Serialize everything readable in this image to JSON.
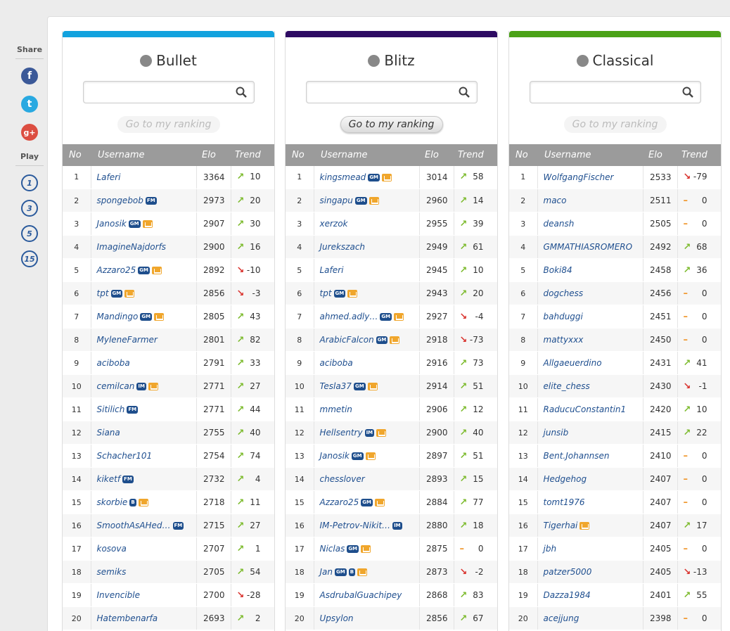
{
  "share": {
    "title": "Share",
    "items": [
      "f",
      "t",
      "g+"
    ]
  },
  "play": {
    "title": "Play",
    "items": [
      "1",
      "3",
      "5",
      "15"
    ]
  },
  "columns_header": {
    "no": "No",
    "username": "Username",
    "elo": "Elo",
    "trend": "Trend"
  },
  "goto_label": "Go to my ranking",
  "colors": {
    "bullet": "#12a2de",
    "blitz": "#2e0b63",
    "classical": "#4ba217",
    "up": "#7dbb2e",
    "down": "#d9322d",
    "flat": "#f0962b"
  },
  "panels": [
    {
      "id": "bullet",
      "title": "Bullet",
      "icon": "bullet-icon",
      "goto_active": false,
      "rows": [
        {
          "no": "1",
          "user": "Laferi",
          "badges": [],
          "elo": "3364",
          "dir": "up",
          "trend": "10"
        },
        {
          "no": "2",
          "user": "spongebob",
          "badges": [
            "FM"
          ],
          "elo": "2973",
          "dir": "up",
          "trend": "20"
        },
        {
          "no": "3",
          "user": "Janosik",
          "badges": [
            "GM",
            "crown"
          ],
          "elo": "2907",
          "dir": "up",
          "trend": "30"
        },
        {
          "no": "4",
          "user": "ImagineNajdorfs",
          "badges": [],
          "elo": "2900",
          "dir": "up",
          "trend": "16"
        },
        {
          "no": "5",
          "user": "Azzaro25",
          "badges": [
            "GM",
            "crown"
          ],
          "elo": "2892",
          "dir": "down",
          "trend": "-10"
        },
        {
          "no": "6",
          "user": "tpt",
          "badges": [
            "GM",
            "crown"
          ],
          "elo": "2856",
          "dir": "down",
          "trend": "-3"
        },
        {
          "no": "7",
          "user": "Mandingo",
          "badges": [
            "GM",
            "crown"
          ],
          "elo": "2805",
          "dir": "up",
          "trend": "43"
        },
        {
          "no": "8",
          "user": "MyleneFarmer",
          "badges": [],
          "elo": "2801",
          "dir": "up",
          "trend": "82"
        },
        {
          "no": "9",
          "user": "aciboba",
          "badges": [],
          "elo": "2791",
          "dir": "up",
          "trend": "33"
        },
        {
          "no": "10",
          "user": "cemilcan",
          "badges": [
            "IM",
            "crown"
          ],
          "elo": "2771",
          "dir": "up",
          "trend": "27"
        },
        {
          "no": "11",
          "user": "Sitilich",
          "badges": [
            "FM"
          ],
          "elo": "2771",
          "dir": "up",
          "trend": "44"
        },
        {
          "no": "12",
          "user": "Siana",
          "badges": [],
          "elo": "2755",
          "dir": "up",
          "trend": "40"
        },
        {
          "no": "13",
          "user": "Schacher101",
          "badges": [],
          "elo": "2754",
          "dir": "up",
          "trend": "74"
        },
        {
          "no": "14",
          "user": "kiketf",
          "badges": [
            "FM"
          ],
          "elo": "2732",
          "dir": "up",
          "trend": "4"
        },
        {
          "no": "15",
          "user": "skorbie",
          "badges": [
            "B",
            "crown"
          ],
          "elo": "2718",
          "dir": "up",
          "trend": "11"
        },
        {
          "no": "16",
          "user": "SmoothAsAHed…",
          "badges": [
            "FM"
          ],
          "elo": "2715",
          "dir": "up",
          "trend": "27"
        },
        {
          "no": "17",
          "user": "kosova",
          "badges": [],
          "elo": "2707",
          "dir": "up",
          "trend": "1"
        },
        {
          "no": "18",
          "user": "semiks",
          "badges": [],
          "elo": "2705",
          "dir": "up",
          "trend": "54"
        },
        {
          "no": "19",
          "user": "Invencible",
          "badges": [],
          "elo": "2700",
          "dir": "down",
          "trend": "-28"
        },
        {
          "no": "20",
          "user": "Hatembenarfa",
          "badges": [],
          "elo": "2693",
          "dir": "up",
          "trend": "2"
        }
      ]
    },
    {
      "id": "blitz",
      "title": "Blitz",
      "icon": "lightning-icon",
      "goto_active": true,
      "rows": [
        {
          "no": "1",
          "user": "kingsmead",
          "badges": [
            "GM",
            "crown"
          ],
          "elo": "3014",
          "dir": "up",
          "trend": "58"
        },
        {
          "no": "2",
          "user": "singapu",
          "badges": [
            "GM",
            "crown"
          ],
          "elo": "2960",
          "dir": "up",
          "trend": "14"
        },
        {
          "no": "3",
          "user": "xerzok",
          "badges": [],
          "elo": "2955",
          "dir": "up",
          "trend": "39"
        },
        {
          "no": "4",
          "user": "Jurekszach",
          "badges": [],
          "elo": "2949",
          "dir": "up",
          "trend": "61"
        },
        {
          "no": "5",
          "user": "Laferi",
          "badges": [],
          "elo": "2945",
          "dir": "up",
          "trend": "10"
        },
        {
          "no": "6",
          "user": "tpt",
          "badges": [
            "GM",
            "crown"
          ],
          "elo": "2943",
          "dir": "up",
          "trend": "20"
        },
        {
          "no": "7",
          "user": "ahmed.adly…",
          "badges": [
            "GM",
            "crown"
          ],
          "elo": "2927",
          "dir": "down",
          "trend": "-4"
        },
        {
          "no": "8",
          "user": "ArabicFalcon",
          "badges": [
            "GM",
            "crown"
          ],
          "elo": "2918",
          "dir": "down",
          "trend": "-73"
        },
        {
          "no": "9",
          "user": "aciboba",
          "badges": [],
          "elo": "2916",
          "dir": "up",
          "trend": "73"
        },
        {
          "no": "10",
          "user": "Tesla37",
          "badges": [
            "GM",
            "crown"
          ],
          "elo": "2914",
          "dir": "up",
          "trend": "51"
        },
        {
          "no": "11",
          "user": "mmetin",
          "badges": [],
          "elo": "2906",
          "dir": "up",
          "trend": "12"
        },
        {
          "no": "12",
          "user": "Hellsentry",
          "badges": [
            "IM",
            "crown"
          ],
          "elo": "2900",
          "dir": "up",
          "trend": "40"
        },
        {
          "no": "13",
          "user": "Janosik",
          "badges": [
            "GM",
            "crown"
          ],
          "elo": "2897",
          "dir": "up",
          "trend": "51"
        },
        {
          "no": "14",
          "user": "chesslover",
          "badges": [],
          "elo": "2893",
          "dir": "up",
          "trend": "15"
        },
        {
          "no": "15",
          "user": "Azzaro25",
          "badges": [
            "GM",
            "crown"
          ],
          "elo": "2884",
          "dir": "up",
          "trend": "77"
        },
        {
          "no": "16",
          "user": "IM-Petrov-Nikit…",
          "badges": [
            "IM"
          ],
          "elo": "2880",
          "dir": "up",
          "trend": "18"
        },
        {
          "no": "17",
          "user": "Niclas",
          "badges": [
            "GM",
            "crown"
          ],
          "elo": "2875",
          "dir": "flat",
          "trend": "0"
        },
        {
          "no": "18",
          "user": "Jan",
          "badges": [
            "GM",
            "B",
            "crown"
          ],
          "elo": "2873",
          "dir": "down",
          "trend": "-2"
        },
        {
          "no": "19",
          "user": "AsdrubalGuachipey",
          "badges": [],
          "elo": "2868",
          "dir": "up",
          "trend": "83"
        },
        {
          "no": "20",
          "user": "Upsylon",
          "badges": [],
          "elo": "2856",
          "dir": "up",
          "trend": "67"
        }
      ]
    },
    {
      "id": "classical",
      "title": "Classical",
      "icon": "tree-icon",
      "goto_active": false,
      "rows": [
        {
          "no": "1",
          "user": "WolfgangFischer",
          "badges": [],
          "elo": "2533",
          "dir": "down",
          "trend": "-79"
        },
        {
          "no": "2",
          "user": "maco",
          "badges": [],
          "elo": "2511",
          "dir": "flat",
          "trend": "0"
        },
        {
          "no": "3",
          "user": "deansh",
          "badges": [],
          "elo": "2505",
          "dir": "flat",
          "trend": "0"
        },
        {
          "no": "4",
          "user": "GMMATHIASROMERO",
          "badges": [],
          "elo": "2492",
          "dir": "up",
          "trend": "68"
        },
        {
          "no": "5",
          "user": "Boki84",
          "badges": [],
          "elo": "2458",
          "dir": "up",
          "trend": "36"
        },
        {
          "no": "6",
          "user": "dogchess",
          "badges": [],
          "elo": "2456",
          "dir": "flat",
          "trend": "0"
        },
        {
          "no": "7",
          "user": "bahduggi",
          "badges": [],
          "elo": "2451",
          "dir": "flat",
          "trend": "0"
        },
        {
          "no": "8",
          "user": "mattyxxx",
          "badges": [],
          "elo": "2450",
          "dir": "flat",
          "trend": "0"
        },
        {
          "no": "9",
          "user": "Allgaeuerdino",
          "badges": [],
          "elo": "2431",
          "dir": "up",
          "trend": "41"
        },
        {
          "no": "10",
          "user": "elite_chess",
          "badges": [],
          "elo": "2430",
          "dir": "down",
          "trend": "-1"
        },
        {
          "no": "11",
          "user": "RaducuConstantin1",
          "badges": [],
          "elo": "2420",
          "dir": "up",
          "trend": "10"
        },
        {
          "no": "12",
          "user": "junsib",
          "badges": [],
          "elo": "2415",
          "dir": "up",
          "trend": "22"
        },
        {
          "no": "13",
          "user": "Bent.Johannsen",
          "badges": [],
          "elo": "2410",
          "dir": "flat",
          "trend": "0"
        },
        {
          "no": "14",
          "user": "Hedgehog",
          "badges": [],
          "elo": "2407",
          "dir": "flat",
          "trend": "0"
        },
        {
          "no": "15",
          "user": "tomt1976",
          "badges": [],
          "elo": "2407",
          "dir": "flat",
          "trend": "0"
        },
        {
          "no": "16",
          "user": "Tigerhai",
          "badges": [
            "crown"
          ],
          "elo": "2407",
          "dir": "up",
          "trend": "17"
        },
        {
          "no": "17",
          "user": "jbh",
          "badges": [],
          "elo": "2405",
          "dir": "flat",
          "trend": "0"
        },
        {
          "no": "18",
          "user": "patzer5000",
          "badges": [],
          "elo": "2405",
          "dir": "down",
          "trend": "-13"
        },
        {
          "no": "19",
          "user": "Dazza1984",
          "badges": [],
          "elo": "2401",
          "dir": "up",
          "trend": "55"
        },
        {
          "no": "20",
          "user": "acejjung",
          "badges": [],
          "elo": "2398",
          "dir": "flat",
          "trend": "0"
        }
      ]
    }
  ]
}
